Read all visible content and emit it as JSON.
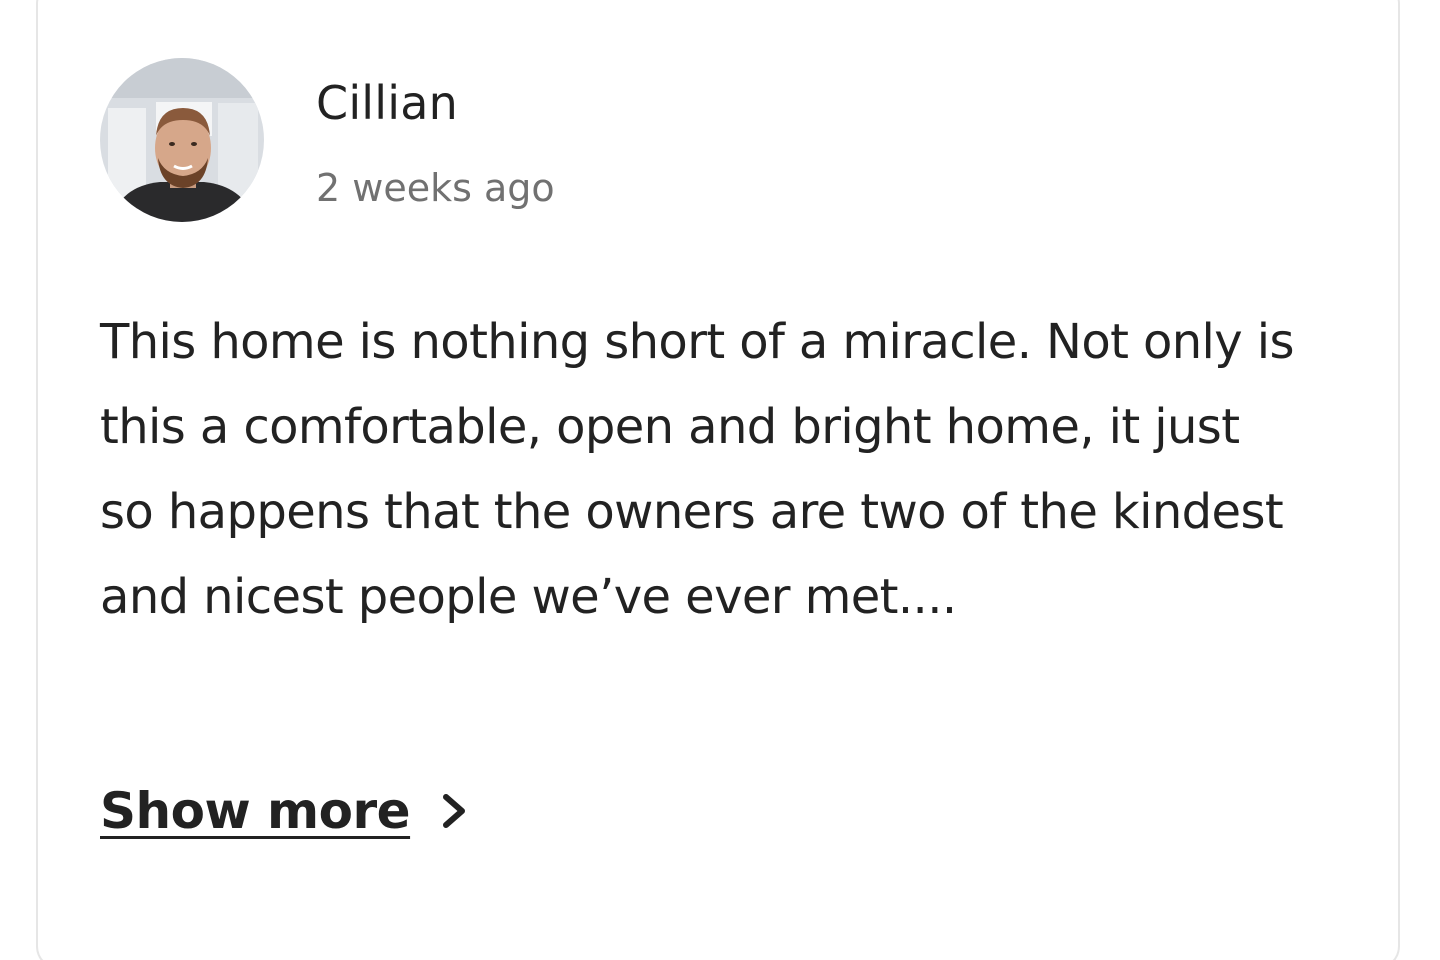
{
  "review": {
    "reviewer_name": "Cillian",
    "date": "2 weeks ago",
    "text": "This home is nothing short of a miracle. Not only is this a comfortable, open and bright home, it just so happens that the owners are two of the kindest and nicest people we’ve ever met....",
    "show_more_label": "Show more",
    "avatar_icon": "user-avatar-photo",
    "chevron_icon": "chevron-right-icon"
  },
  "colors": {
    "text_primary": "#222222",
    "text_secondary": "#717171",
    "card_border": "#e6e6e6"
  }
}
